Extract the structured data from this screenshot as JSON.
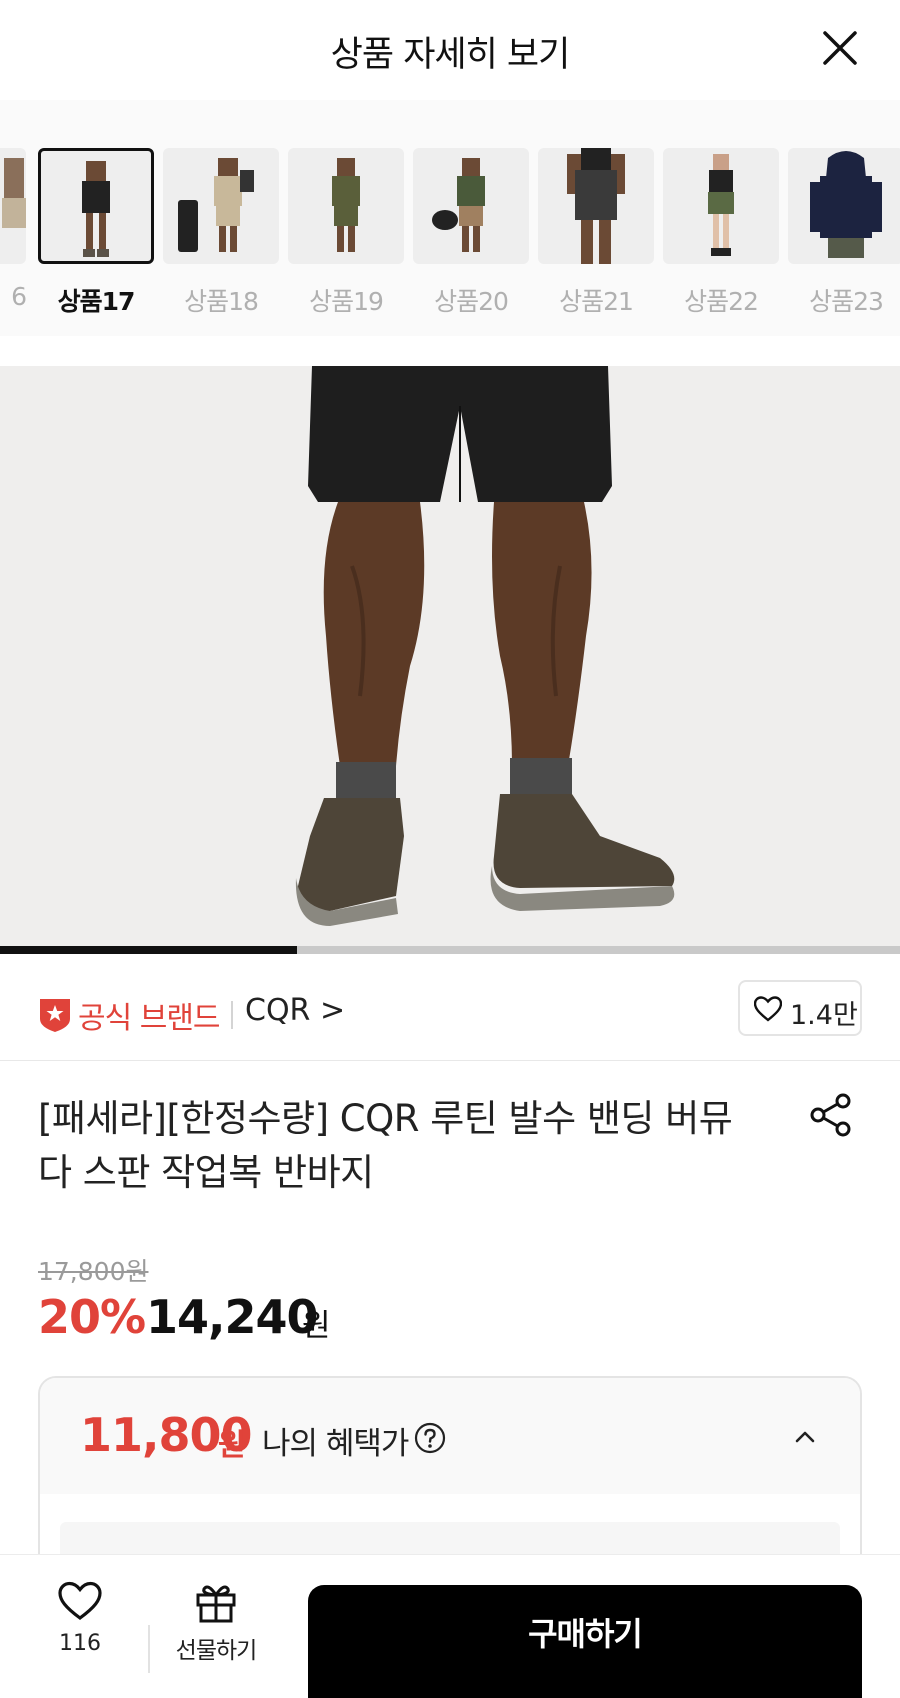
{
  "header": {
    "title": "상품 자세히 보기",
    "close_icon": "close-icon"
  },
  "thumbnails": [
    {
      "label": "6",
      "active": false
    },
    {
      "label": "상품17",
      "active": true
    },
    {
      "label": "상품18",
      "active": false
    },
    {
      "label": "상품19",
      "active": false
    },
    {
      "label": "상품20",
      "active": false
    },
    {
      "label": "상품21",
      "active": false
    },
    {
      "label": "상품22",
      "active": false
    },
    {
      "label": "상품23",
      "active": false
    }
  ],
  "gallery": {
    "progress": 0.33
  },
  "brand": {
    "badge_label": "공식 브랜드",
    "name": "CQR >",
    "like_count": "1.4만"
  },
  "product": {
    "title": "[패세라][한정수량] CQR 루틴 발수 밴딩 버뮤다 스판 작업복 반바지",
    "original_price": "17,800원",
    "discount": "20%",
    "sale_price": "14,240",
    "sale_unit": "원"
  },
  "benefit": {
    "price": "11,800",
    "unit": "원",
    "label": "나의 혜택가"
  },
  "bottom_bar": {
    "wish_count": "116",
    "gift_label": "선물하기",
    "buy_label": "구매하기"
  },
  "colors": {
    "accent_red": "#e0433a",
    "buy_button": "#000000"
  }
}
